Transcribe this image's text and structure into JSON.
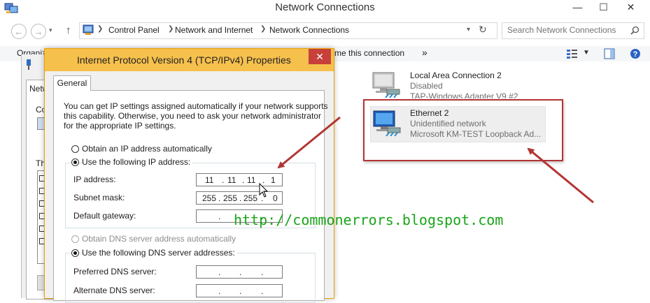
{
  "window": {
    "title": "Network Connections",
    "minimize": "—",
    "maximize": "☐",
    "close": "✕"
  },
  "nav": {
    "back": "←",
    "forward": "→",
    "up": "↑",
    "breadcrumbs": [
      "Control Panel",
      "Network and Internet",
      "Network Connections"
    ],
    "refresh": "↻"
  },
  "search": {
    "placeholder": "Search Network Connections"
  },
  "toolbar": {
    "organize": "Organiz",
    "rename": "me this connection",
    "more": "»"
  },
  "adapters": [
    {
      "name": "Local Area Connection 2",
      "status": "Disabled",
      "device": "TAP-Windows Adapter V9 #2"
    },
    {
      "name": "Ethernet 2",
      "status": "Unidentified network",
      "device": "Microsoft KM-TEST Loopback Ad..."
    }
  ],
  "background_dialog": {
    "tab_fragment": "Netw",
    "text_fragment_1": "Co",
    "text_fragment_2": "Th"
  },
  "dialog": {
    "title": "Internet Protocol Version 4 (TCP/IPv4) Properties",
    "close": "✕",
    "tab": "General",
    "description_lines": [
      "You can get IP settings assigned automatically if your network supports",
      "this capability. Otherwise, you need to ask your network administrator",
      "for the appropriate IP settings."
    ],
    "ip_auto_label": "Obtain an IP address automatically",
    "ip_manual_label": "Use the following IP address:",
    "ip_address_label": "IP address:",
    "ip_address": [
      "11",
      "11",
      "11",
      "1"
    ],
    "subnet_label": "Subnet mask:",
    "subnet_mask": [
      "255",
      "255",
      "255",
      "0"
    ],
    "gateway_label": "Default gateway:",
    "dns_auto_label": "Obtain DNS server address automatically",
    "dns_manual_label": "Use the following DNS server addresses:",
    "preferred_dns_label": "Preferred DNS server:",
    "alternate_dns_label": "Alternate DNS server:",
    "dot": "."
  },
  "watermark": {
    "text": "http://commonerrors.blogspot.com"
  },
  "colors": {
    "dialog_title_bar": "#f6c04d",
    "close_button": "#c7403a",
    "annotation": "#b33434",
    "watermark": "#1aa51a"
  }
}
